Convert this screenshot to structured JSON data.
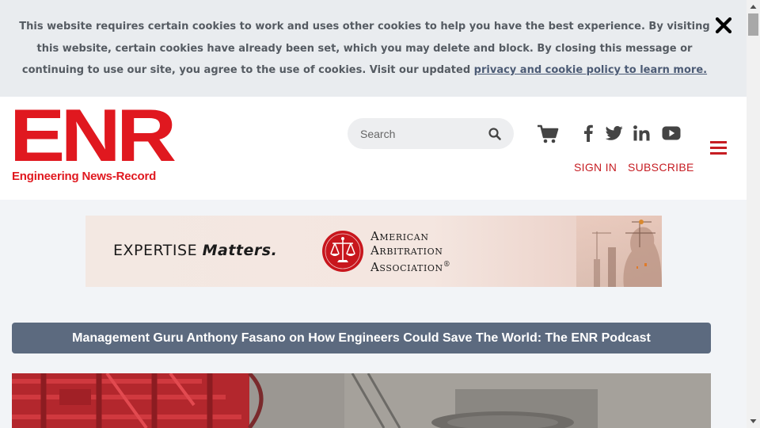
{
  "cookie_banner": {
    "message": "This website requires certain cookies to work and uses other cookies to help you have the best experience. By visiting this website, certain cookies have already been set, which you may delete and block. By closing this message or continuing to use our site, you agree to the use of cookies. Visit our updated ",
    "link_text": "privacy and cookie policy to learn more."
  },
  "header": {
    "logo_text": "ENR",
    "logo_subtitle": "Engineering News-Record",
    "search_placeholder": "Search",
    "sign_in": "SIGN IN",
    "subscribe": "SUBSCRIBE",
    "icons": [
      "search-icon",
      "cart-icon",
      "facebook-icon",
      "twitter-icon",
      "linkedin-icon",
      "youtube-icon",
      "menu-icon"
    ]
  },
  "ad": {
    "tagline_prefix": "EXPERTISE",
    "tagline_emphasis": "Matters.",
    "org_line1": "American",
    "org_line2": "Arbitration",
    "org_line3": "Association",
    "registered": "®"
  },
  "headline": {
    "title": "Management Guru Anthony Fasano on How Engineers Could Save The World: The ENR Podcast"
  },
  "colors": {
    "brand_red": "#e0181f",
    "link_red": "#c61d23",
    "headline_bg": "#5c6a7f",
    "banner_bg": "#e9ecef"
  }
}
